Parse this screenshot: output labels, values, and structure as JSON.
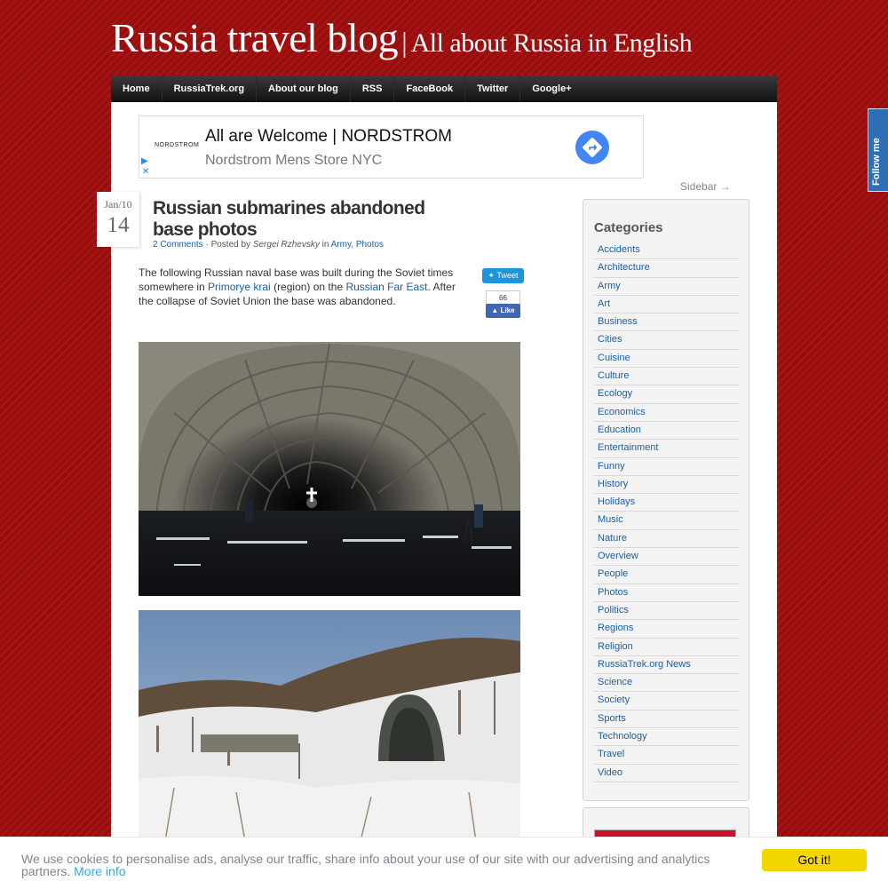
{
  "site": {
    "title": "Russia travel blog",
    "separator": "|",
    "tagline": "All about Russia in English"
  },
  "nav": {
    "items": [
      {
        "label": "Home"
      },
      {
        "label": "RussiaTrek.org"
      },
      {
        "label": "About our blog"
      },
      {
        "label": "RSS"
      },
      {
        "label": "FaceBook"
      },
      {
        "label": "Twitter"
      },
      {
        "label": "Google+"
      }
    ]
  },
  "ad": {
    "logo": "NORDSTROM",
    "headline": "All are Welcome | NORDSTROM",
    "subline": "Nordstrom Mens Store NYC",
    "button_icon": "directions-arrow-icon",
    "adchoices_icon": "play-triangle-icon",
    "close_icon": "close-icon"
  },
  "sidebar_toggle": "Sidebar →",
  "post": {
    "date_month": "Jan/10",
    "date_day": "14",
    "title": "Russian submarines abandoned base photos",
    "meta": {
      "comments": "2 Comments",
      "sep1": " · Posted by ",
      "author": "Sergei Rzhevsky",
      "in": " in ",
      "cat1": "Army",
      "comma": ", ",
      "cat2": "Photos"
    },
    "body": {
      "t1": "The following Russian naval base was built during the Soviet times somewhere in ",
      "link1": "Primorye krai",
      "t2": " (region) on the ",
      "link2": "Russian Far East",
      "t3": ". After the collapse of Soviet Union the base was abandoned."
    },
    "social": {
      "tweet": "Tweet",
      "like_count": "66",
      "like": "Like"
    }
  },
  "sidebar": {
    "heading": "Categories",
    "categories": [
      "Accidents",
      "Architecture",
      "Army",
      "Art",
      "Business",
      "Cities",
      "Cuisine",
      "Culture",
      "Ecology",
      "Economics",
      "Education",
      "Entertainment",
      "Funny",
      "History",
      "Holidays",
      "Music",
      "Nature",
      "Overview",
      "People",
      "Photos",
      "Politics",
      "Regions",
      "Religion",
      "RussiaTrek.org News",
      "Science",
      "Society",
      "Sports",
      "Technology",
      "Travel",
      "Video"
    ]
  },
  "follow": {
    "label": "Follow me"
  },
  "cookie": {
    "text": "We use cookies to personalise ads, analyse our traffic, share info about your use of our site with our advertising and analytics partners. ",
    "more": "More info",
    "button": "Got it!"
  },
  "colors": {
    "background": "#9b0d0d",
    "link": "#1a5fa8",
    "cookie_button": "#f1d600",
    "tweet": "#1b95e0",
    "facebook": "#4267b2"
  }
}
